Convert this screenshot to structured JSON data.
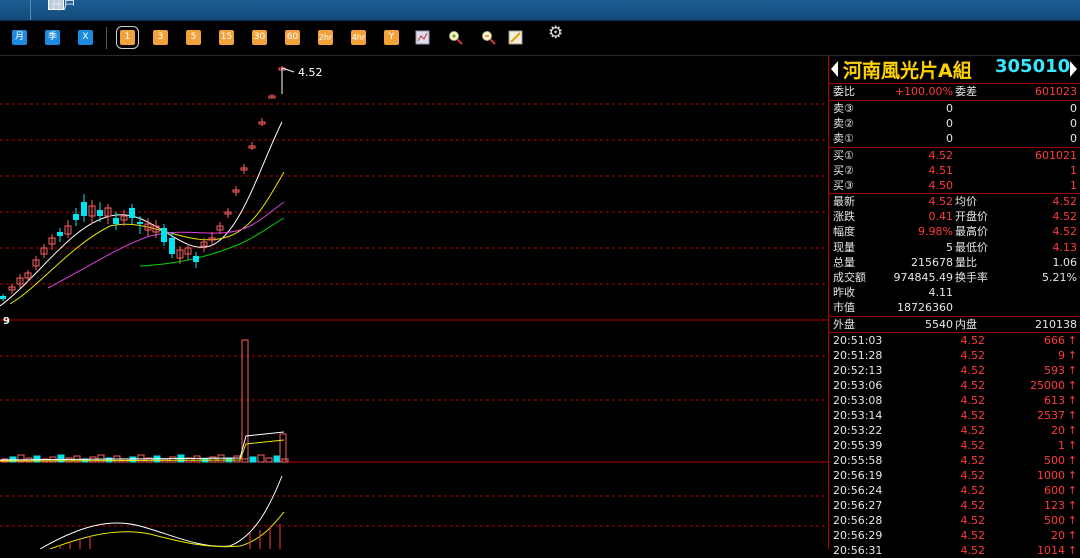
{
  "window": {
    "title": "开户"
  },
  "toolbar": {
    "periods": [
      "月",
      "季",
      "X"
    ],
    "intervals": [
      "1",
      "3",
      "5",
      "15",
      "30",
      "60",
      "2hr",
      "4hr",
      "Y"
    ],
    "tool_icons": [
      "chart-icon",
      "zoom-in-icon",
      "zoom-out-icon",
      "draw-icon"
    ],
    "settings_icon": "gear-icon"
  },
  "chart": {
    "high_label": "4.52",
    "corner_label": "9"
  },
  "quote": {
    "name": "河南風光片A組",
    "code": "305010",
    "weibi_label": "委比",
    "weibi_value": "+100.00%",
    "weicha_label": "委差",
    "weicha_value": "601023",
    "asks": [
      {
        "label": "卖③",
        "price": "0",
        "vol": "0"
      },
      {
        "label": "卖②",
        "price": "0",
        "vol": "0"
      },
      {
        "label": "卖①",
        "price": "0",
        "vol": "0"
      }
    ],
    "bids": [
      {
        "label": "买①",
        "price": "4.52",
        "vol": "601021"
      },
      {
        "label": "买②",
        "price": "4.51",
        "vol": "1"
      },
      {
        "label": "买③",
        "price": "4.50",
        "vol": "1"
      }
    ],
    "stats": [
      {
        "l1": "最新",
        "v1": "4.52",
        "l2": "均价",
        "v2": "4.52"
      },
      {
        "l1": "涨跌",
        "v1": "0.41",
        "l2": "开盘价",
        "v2": "4.52"
      },
      {
        "l1": "幅度",
        "v1": "9.98%",
        "l2": "最高价",
        "v2": "4.52"
      },
      {
        "l1": "现量",
        "v1": "5",
        "l2": "最低价",
        "v2": "4.13"
      },
      {
        "l1": "总量",
        "v1": "215678",
        "l2": "量比",
        "v2": "1.06"
      },
      {
        "l1": "成交额",
        "v1": "974845.49",
        "l2": "换手率",
        "v2": "5.21%"
      },
      {
        "l1": "昨收",
        "v1": "4.11",
        "l2": "",
        "v2": ""
      },
      {
        "l1": "市值",
        "v1": "18726360",
        "l2": "",
        "v2": ""
      }
    ],
    "outer_label": "外盘",
    "outer_value": "5540",
    "inner_label": "内盘",
    "inner_value": "210138",
    "ticks": [
      {
        "time": "20:51:03",
        "price": "4.52",
        "vol": "666"
      },
      {
        "time": "20:51:28",
        "price": "4.52",
        "vol": "9"
      },
      {
        "time": "20:52:13",
        "price": "4.52",
        "vol": "593"
      },
      {
        "time": "20:53:06",
        "price": "4.52",
        "vol": "25000"
      },
      {
        "time": "20:53:08",
        "price": "4.52",
        "vol": "613"
      },
      {
        "time": "20:53:14",
        "price": "4.52",
        "vol": "2537"
      },
      {
        "time": "20:53:22",
        "price": "4.52",
        "vol": "20"
      },
      {
        "time": "20:55:39",
        "price": "4.52",
        "vol": "1"
      },
      {
        "time": "20:55:58",
        "price": "4.52",
        "vol": "500"
      },
      {
        "time": "20:56:19",
        "price": "4.52",
        "vol": "1000"
      },
      {
        "time": "20:56:24",
        "price": "4.52",
        "vol": "600"
      },
      {
        "time": "20:56:27",
        "price": "4.52",
        "vol": "123"
      },
      {
        "time": "20:56:28",
        "price": "4.52",
        "vol": "500"
      },
      {
        "time": "20:56:29",
        "price": "4.52",
        "vol": "20"
      },
      {
        "time": "20:56:31",
        "price": "4.52",
        "vol": "1014"
      }
    ],
    "tick_arrow": "↑"
  },
  "colors": {
    "up": "#ff3b3b",
    "down": "#00e4f0",
    "grid": "#b80000",
    "ma1": "#ffffff",
    "ma2": "#e6e600",
    "ma3": "#e040e0",
    "ma4": "#00d200"
  }
}
